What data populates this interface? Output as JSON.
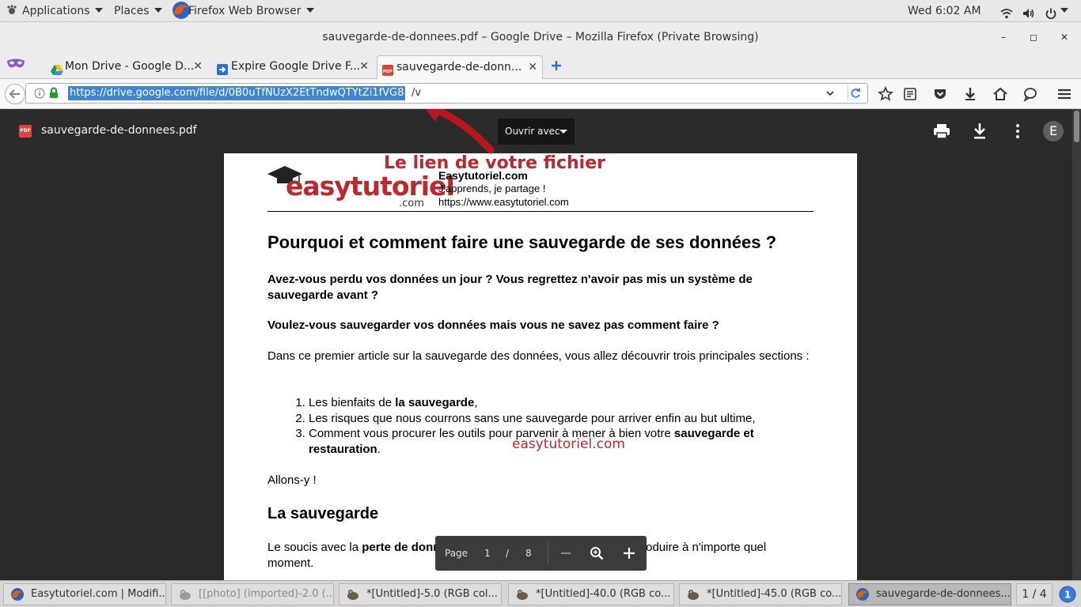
{
  "topbar": {
    "applications": "Applications",
    "places": "Places",
    "active_app": "Firefox Web Browser",
    "clock": "Wed  6:02 AM"
  },
  "window": {
    "title": "sauvegarde-de-donnees.pdf – Google Drive – Mozilla Firefox (Private Browsing)",
    "minimize": "–",
    "maximize": "◻",
    "close": "✕"
  },
  "tabs": [
    {
      "label": "Mon Drive - Google D...",
      "icon": "google-drive-icon"
    },
    {
      "label": "Expire Google Drive F...",
      "icon": "arrow-icon"
    },
    {
      "label": "sauvegarde-de-donn...",
      "icon": "pdf-icon"
    }
  ],
  "navbar": {
    "url_selected": "https://drive.google.com/file/d/0B0uTfNUzX2EtTndwQTYtZi1fVG8",
    "url_rest": "/v"
  },
  "viewer": {
    "file_icon_label": "PDF",
    "file_name": "sauvegarde-de-donnees.pdf",
    "open_with": "Ouvrir avec",
    "avatar": "E"
  },
  "annotations": {
    "link_label": "Le lien de votre fichier",
    "watermark": "easytutoriel.com"
  },
  "document": {
    "logo_text": "easytutoriel",
    "logo_suffix": ".com",
    "site_name": "Easytutoriel.com",
    "site_tagline": "J'apprends, je partage !",
    "site_url": "https://www.easytutoriel.com",
    "heading": "Pourquoi et comment faire une sauvegarde de ses données ?",
    "q1": "Avez-vous perdu vos données un jour ? Vous regrettez n'avoir pas mis un système de sauvegarde avant ?",
    "q2": "Voulez-vous sauvegarder vos données mais vous ne savez pas comment faire ?",
    "intro": "Dans ce premier article sur la sauvegarde des données, vous allez découvrir trois principales sections :",
    "list": {
      "item1_pre": "Les bienfaits de ",
      "item1_bold": "la sauvegarde",
      "item1_post": ",",
      "item2": "Les risques que nous courrons sans une sauvegarde pour arriver enfin au but ultime,",
      "item3_pre": "Comment vous procurer les outils pour parvenir à mener à bien votre ",
      "item3_bold": "sauvegarde et restauration",
      "item3_post": "."
    },
    "allons": "Allons-y !",
    "subheading": "La sauvegarde",
    "last_pre": "Le soucis avec la ",
    "last_bold": "perte de données",
    "last_post": ", c'est que cette dernière peut se produire à n'importe quel moment."
  },
  "pager": {
    "label": "Page",
    "current": "1",
    "sep": "/",
    "total": "8"
  },
  "taskbar": {
    "items": [
      {
        "label": "Easytutoriel.com | Modifi..."
      },
      {
        "label": "[[photo] (imported)-2.0 (..."
      },
      {
        "label": "*[Untitled]-5.0 (RGB col..."
      },
      {
        "label": "*[Untitled]-40.0 (RGB co..."
      },
      {
        "label": "*[Untitled]-45.0 (RGB co..."
      },
      {
        "label": "sauvegarde-de-donnees...."
      }
    ],
    "workspace": "1 / 4"
  }
}
